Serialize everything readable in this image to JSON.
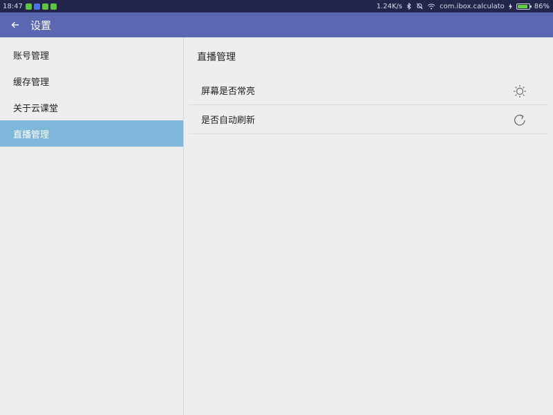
{
  "status_bar": {
    "time": "18:47",
    "notification_colors": [
      "#5dc63a",
      "#4a72e0",
      "#5dc63a",
      "#5dc63a"
    ],
    "net_speed": "1.24K/s",
    "app_package": "com.ibox.calculato",
    "battery": "86%",
    "battery_level": 0.86
  },
  "app_bar": {
    "title": "设置"
  },
  "sidebar": {
    "items": [
      {
        "label": "账号管理",
        "active": false
      },
      {
        "label": "缓存管理",
        "active": false
      },
      {
        "label": "关于云课堂",
        "active": false
      },
      {
        "label": "直播管理",
        "active": true
      }
    ]
  },
  "main": {
    "section_title": "直播管理",
    "settings": [
      {
        "label": "屏幕是否常亮",
        "icon": "brightness-icon"
      },
      {
        "label": "是否自动刷新",
        "icon": "refresh-icon"
      }
    ]
  },
  "colors": {
    "status_bar": "#23264a",
    "app_bar": "#5b67b1",
    "active_item": "#7fb7da",
    "background": "#eeeeee"
  }
}
